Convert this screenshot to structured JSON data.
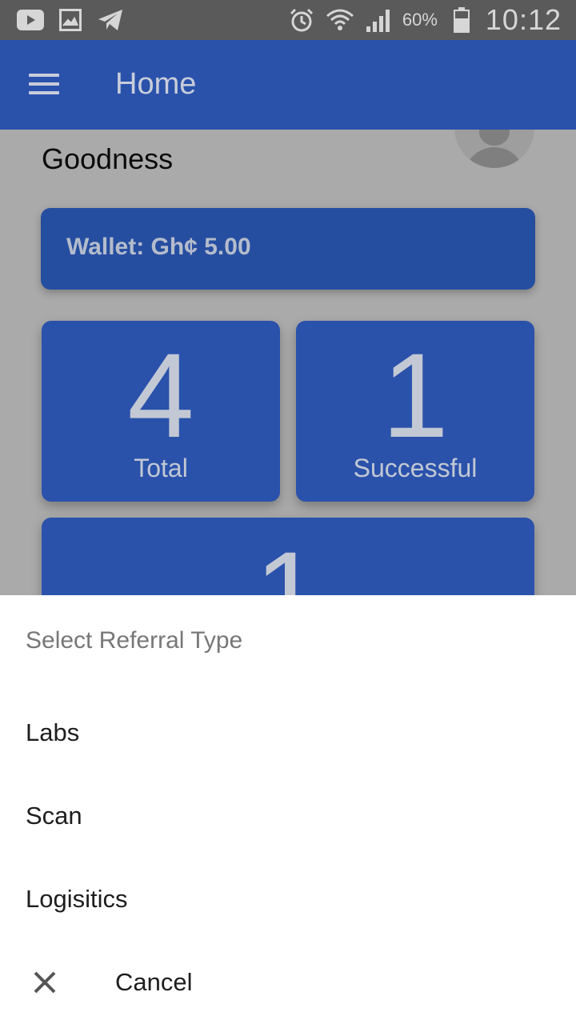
{
  "status_bar": {
    "left_icons": [
      "youtube-icon",
      "gallery-icon",
      "telegram-icon"
    ],
    "right_icons": [
      "alarm-icon",
      "wifi-icon",
      "signal-icon",
      "battery-icon"
    ],
    "battery": "60%",
    "time": "10:12"
  },
  "app_bar": {
    "menu_icon": "menu-icon",
    "title": "Home"
  },
  "home": {
    "username": "Goodness",
    "avatar_icon": "person-icon",
    "wallet_label": "Wallet: Gh¢ 5.00",
    "stats": [
      {
        "value": "4",
        "label": "Total"
      },
      {
        "value": "1",
        "label": "Successful"
      },
      {
        "value": "1",
        "label": ""
      }
    ]
  },
  "sheet": {
    "title": "Select Referral Type",
    "items": [
      {
        "label": "Labs"
      },
      {
        "label": "Scan"
      },
      {
        "label": "Logisitics"
      }
    ],
    "cancel_label": "Cancel",
    "cancel_icon": "close-icon"
  },
  "colors": {
    "status_bar": "#5a5a5a",
    "app_bar": "#2a52ab",
    "card": "#2a52ab",
    "scrim_content": "#aaaaaa",
    "sheet_bg": "#ffffff"
  }
}
